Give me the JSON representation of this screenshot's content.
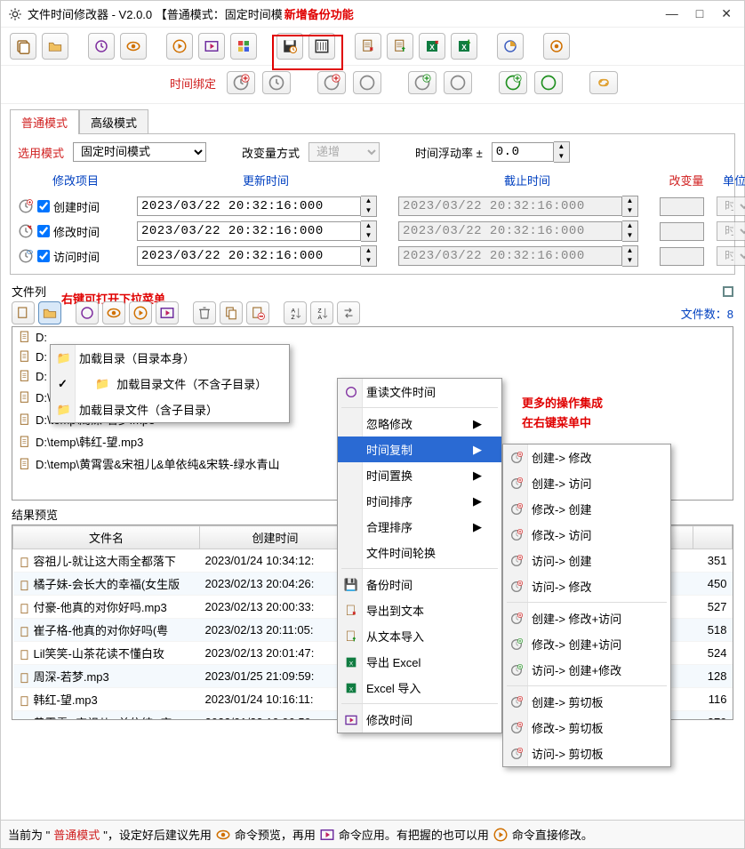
{
  "window": {
    "title": "文件时间修改器    - V2.0.0  【普通模式：固定时间模",
    "annot_new_backup": "新增备份功能",
    "min": "—",
    "max": "□",
    "close": "✕"
  },
  "bindrow_label": "时间绑定",
  "tabs": {
    "normal": "普通模式",
    "advanced": "高级模式"
  },
  "row1": {
    "select_mode": "选用模式",
    "mode_value": "固定时间模式",
    "change_method": "改变量方式",
    "change_value": "递增",
    "float_rate": "时间浮动率 ±",
    "float_value": "0.0"
  },
  "cols": {
    "h1": "修改项目",
    "h2": "更新时间",
    "h3": "截止时间",
    "h4": "改变量",
    "h5": "单位",
    "r1": {
      "name": "创建时间",
      "dt": "2023/03/22 20:32:16:000",
      "dt2": "2023/03/22 20:32:16:000",
      "unit": "时"
    },
    "r2": {
      "name": "修改时间",
      "dt": "2023/03/22 20:32:16:000",
      "dt2": "2023/03/22 20:32:16:000",
      "unit": "时"
    },
    "r3": {
      "name": "访问时间",
      "dt": "2023/03/22 20:32:16:000",
      "dt2": "2023/03/22 20:32:16:000",
      "unit": "时"
    }
  },
  "annot_rightclick": "右键可打开下拉菜单",
  "annot_moreops1": "更多的操作集成",
  "annot_moreops2": "在右键菜单中",
  "filelist_label": "文件列",
  "filecount_label": "文件数：",
  "filecount": "8",
  "files": [
    "D:",
    "D:",
    "D:",
    "D:\\temp\\Lil笑笑-山茶花读不懂白玫瑰.mp3",
    "D:\\temp\\周深-若梦.mp3",
    "D:\\temp\\韩红-望.mp3",
    "D:\\temp\\黄霄雲&宋祖儿&单依纯&宋轶-绿水青山"
  ],
  "files_partial": [
    "3",
    "p3"
  ],
  "ctx1": {
    "i1": "加载目录（目录本身）",
    "i2": "加载目录文件（不含子目录）",
    "i3": "加载目录文件（含子目录）"
  },
  "ctx2": {
    "reread": "重读文件时间",
    "ignore": "忽略修改",
    "copy": "时间复制",
    "swap": "时间置换",
    "sort": "时间排序",
    "reason": "合理排序",
    "rotate": "文件时间轮换",
    "backup": "备份时间",
    "exptxt": "导出到文本",
    "imptxt": "从文本导入",
    "expxls": "导出 Excel",
    "impxls": "Excel 导入",
    "modtime": "修改时间"
  },
  "ctx3": [
    "创建-> 修改",
    "创建-> 访问",
    "修改-> 创建",
    "修改-> 访问",
    "访问-> 创建",
    "访问-> 修改",
    "创建-> 修改+访问",
    "修改-> 创建+访问",
    "访问-> 创建+修改",
    "创建-> 剪切板",
    "修改-> 剪切板",
    "访问-> 剪切板"
  ],
  "results_label": "结果预览",
  "rescols": {
    "c1": "文件名",
    "c2": "创建时间",
    "cR": ""
  },
  "resrows": [
    {
      "fn": "容祖儿-就让这大雨全都落下",
      "ct": "2023/01/24 10:34:12:",
      "tail": "351"
    },
    {
      "fn": "橘子妹-会长大的幸福(女生版",
      "ct": "2023/02/13 20:04:26:",
      "tail": "450"
    },
    {
      "fn": "付豪-他真的对你好吗.mp3",
      "ct": "2023/02/13 20:00:33:",
      "tail": "527"
    },
    {
      "fn": "崔子格-他真的对你好吗(粤",
      "ct": "2023/02/13 20:11:05:",
      "tail": "518"
    },
    {
      "fn": "Lil笑笑-山茶花读不懂白玫",
      "ct": "2023/02/13 20:01:47:",
      "tail": "524"
    },
    {
      "fn": "周深-若梦.mp3",
      "ct": "2023/01/25 21:09:59:",
      "tail": "128"
    },
    {
      "fn": "韩红-望.mp3",
      "ct": "2023/01/24 10:16:11:",
      "tail": "116"
    },
    {
      "fn": "黄霄雲&宋祖儿&单依纯&宋",
      "ct": "2023/01/22 10:06:59:",
      "tail": "279"
    }
  ],
  "status": {
    "pre1": "当前为 \"",
    "mode": "普通模式",
    "pre2": "\"，设定好后建议先用",
    "preview": "命令预览，再用",
    "apply": "命令应用。有把握的也可以用",
    "direct": "命令直接修改。"
  }
}
